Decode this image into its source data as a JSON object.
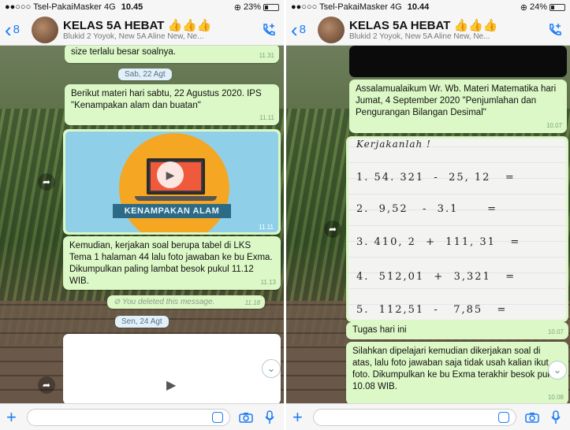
{
  "left": {
    "status": {
      "carrier": "●●○○○ Tsel-PakaiMasker",
      "network": "4G",
      "time": "10.45",
      "battery": "23%",
      "battery_fraction": 0.23
    },
    "header": {
      "back_count": "8",
      "group_name": "KELAS 5A HEBAT 👍👍👍",
      "members": "Blukid 2 Yoyok, New 5A Aline New, Ne..."
    },
    "messages": {
      "m1": {
        "text": "size terlalu besar soalnya.",
        "time": "11.31"
      },
      "date1": "Sab, 22 Agt",
      "m2": {
        "text": "Berikut materi hari sabtu, 22 Agustus 2020. IPS \"Kenampakan alam dan buatan\"",
        "time": "11.11"
      },
      "video": {
        "banner": "KENAMPAKAN ALAM",
        "time": "11.11"
      },
      "m3": {
        "text": "Kemudian, kerjakan soal berupa tabel di LKS Tema 1 halaman 44 lalu foto jawaban ke bu Exma. Dikumpulkan paling lambat besok pukul 11.12 WIB.",
        "time": "11.13"
      },
      "deleted": {
        "text": "You deleted this message.",
        "time": "11.18"
      },
      "date2": "Sen, 24 Agt"
    }
  },
  "right": {
    "status": {
      "carrier": "●●○○○ Tsel-PakaiMasker",
      "network": "4G",
      "time": "10.44",
      "battery": "24%",
      "battery_fraction": 0.24
    },
    "header": {
      "back_count": "8",
      "group_name": "KELAS 5A HEBAT 👍👍👍",
      "members": "Blukid 2 Yoyok, New 5A Aline New, Ne..."
    },
    "messages": {
      "m1": {
        "text": "Assalamualaikum Wr. Wb. Materi Matematika hari Jumat, 4 September 2020 \"Penjumlahan dan Pengurangan Bilangan Desimal\"",
        "time": "10.07"
      },
      "worksheet": {
        "title": "Kerjakanlah !",
        "lines": [
          "1. 54. 321  -  25, 12   =",
          "2.  9,52   -  3.1      =",
          "3. 410, 2  +  111, 31   =",
          "4.  512,01  +  3,321   =",
          "5.  112,51  -   7,85   ="
        ]
      },
      "m2": {
        "text": "Tugas hari ini",
        "time": "10.07"
      },
      "m3": {
        "text": "Silahkan dipelajari kemudian dikerjakan soal di atas, lalu foto jawaban saja tidak usah kalian ikut foto. Dikumpulkan ke bu Exma terakhir besok pukul 10.08 WIB.",
        "time": "10.08"
      }
    }
  }
}
